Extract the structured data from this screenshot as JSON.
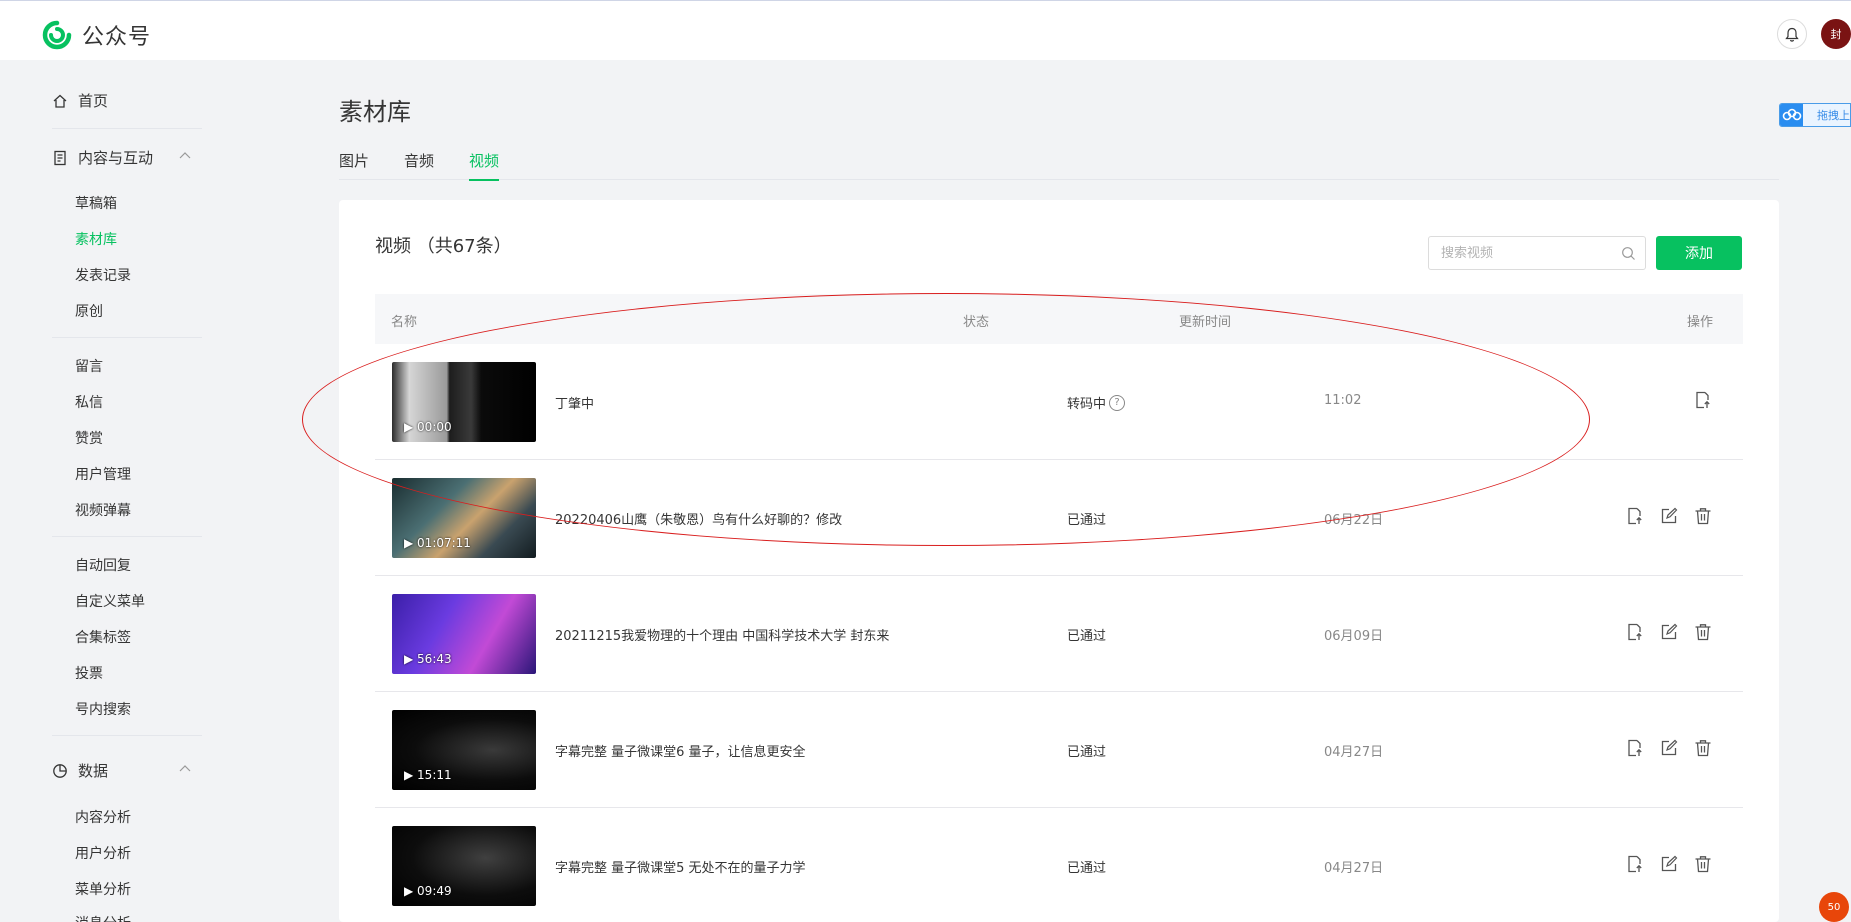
{
  "app": {
    "name": "公众号"
  },
  "header": {
    "avatar_text": "封"
  },
  "sidebar": {
    "home": "首页",
    "content_section": "内容与互动",
    "content_items": [
      "草稿箱",
      "素材库",
      "发表记录",
      "原创"
    ],
    "interaction_items": [
      "留言",
      "私信",
      "赞赏",
      "用户管理",
      "视频弹幕"
    ],
    "feature_items": [
      "自动回复",
      "自定义菜单",
      "合集标签",
      "投票",
      "号内搜索"
    ],
    "data_section": "数据",
    "data_items": [
      "内容分析",
      "用户分析",
      "菜单分析",
      "消息分析"
    ]
  },
  "main": {
    "title": "素材库",
    "tabs": [
      "图片",
      "音频",
      "视频"
    ],
    "active_tab": "视频",
    "panel_title": "视频 （共67条）",
    "search_placeholder": "搜索视频",
    "add_label": "添加",
    "columns": [
      "名称",
      "状态",
      "更新时间",
      "操作"
    ],
    "rows": [
      {
        "duration": "▶ 00:00",
        "name": "丁肇中",
        "status": "转码中",
        "status_help": "?",
        "time": "11:02",
        "ops": [
          "publish-icon"
        ]
      },
      {
        "duration": "▶ 01:07:11",
        "name": "20220406山鹰（朱敬恩）鸟有什么好聊的？修改",
        "status": "已通过",
        "time": "06月22日",
        "ops": [
          "publish-icon",
          "edit-icon",
          "delete-icon"
        ]
      },
      {
        "duration": "▶ 56:43",
        "name": "20211215我爱物理的十个理由 中国科学技术大学 封东来",
        "status": "已通过",
        "time": "06月09日",
        "ops": [
          "publish-icon",
          "edit-icon",
          "delete-icon"
        ]
      },
      {
        "duration": "▶ 15:11",
        "name": "字幕完整 量子微课堂6 量子，让信息更安全",
        "status": "已通过",
        "time": "04月27日",
        "ops": [
          "publish-icon",
          "edit-icon",
          "delete-icon"
        ]
      },
      {
        "duration": "▶ 09:49",
        "name": "字幕完整 量子微课堂5 无处不在的量子力学",
        "status": "已通过",
        "time": "04月27日",
        "ops": [
          "publish-icon",
          "edit-icon",
          "delete-icon"
        ]
      }
    ]
  },
  "float_widget": {
    "label": "拖拽上"
  },
  "notification_badge": "50",
  "colors": {
    "accent": "#07c160",
    "annotation": "#d91e1e",
    "background": "#f2f3f5"
  }
}
